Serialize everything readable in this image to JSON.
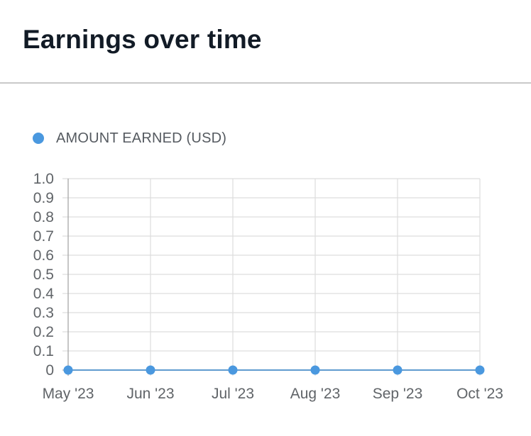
{
  "header": {
    "title": "Earnings over time"
  },
  "legend": {
    "label": "AMOUNT EARNED (USD)",
    "color": "#4a98df"
  },
  "colors": {
    "grid": "#dedede",
    "axis_baseline": "#a8a8a8",
    "line": "#5f9bcf",
    "point": "#4a98df",
    "tick_text": "#606468"
  },
  "chart_data": {
    "type": "line",
    "title": "Earnings over time",
    "xlabel": "",
    "ylabel": "",
    "categories": [
      "May '23",
      "Jun '23",
      "Jul '23",
      "Aug '23",
      "Sep '23",
      "Oct '23"
    ],
    "series": [
      {
        "name": "AMOUNT EARNED (USD)",
        "values": [
          0,
          0,
          0,
          0,
          0,
          0
        ]
      }
    ],
    "ylim": [
      0,
      1
    ],
    "yticks": [
      "0",
      "0.1",
      "0.2",
      "0.3",
      "0.4",
      "0.5",
      "0.6",
      "0.7",
      "0.8",
      "0.9",
      "1.0"
    ],
    "grid": true,
    "legend_position": "top-left"
  }
}
